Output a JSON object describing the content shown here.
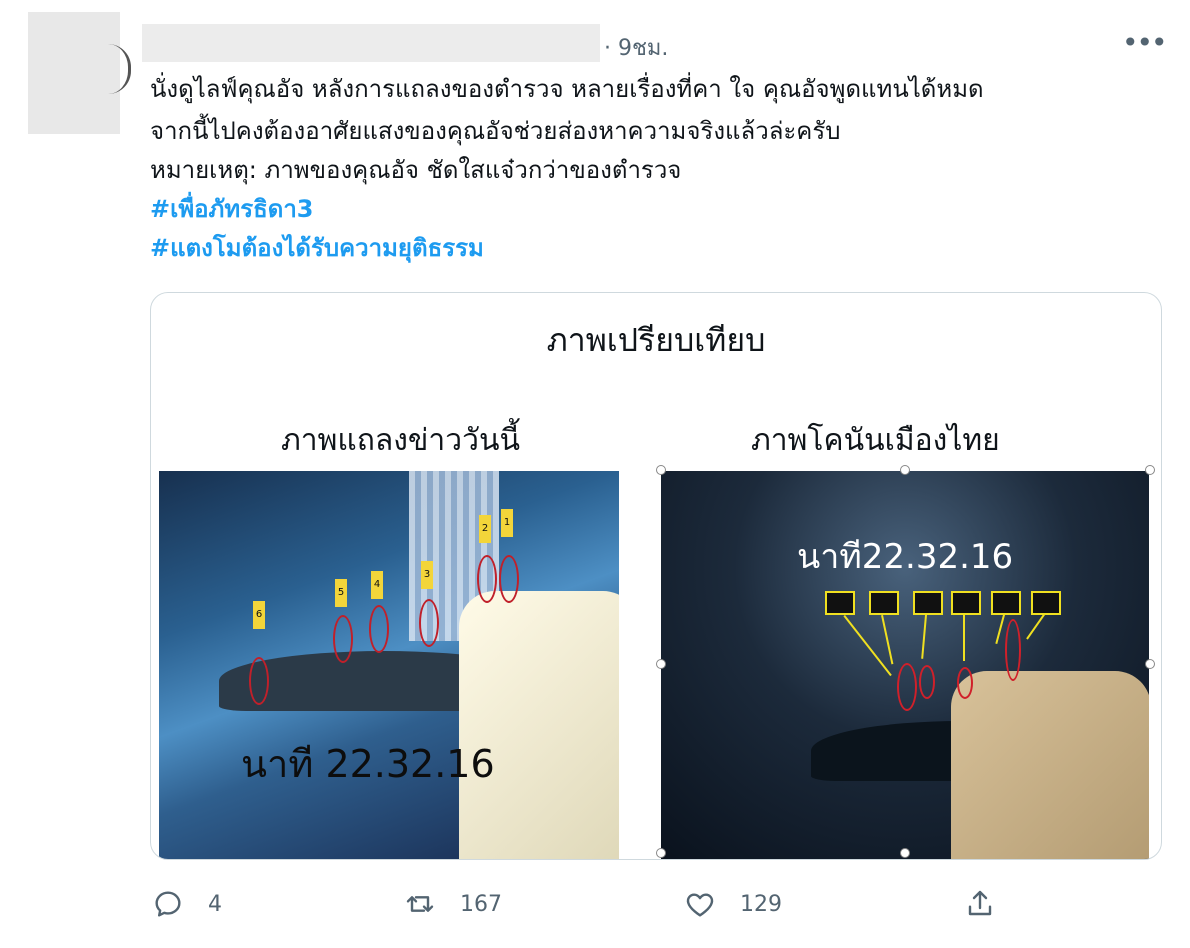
{
  "tweet": {
    "timestamp": "· 9ชม.",
    "more_label": "•••",
    "lines": [
      "นั่งดูไลฟ์คุณอัจ หลังการแถลงของตำรวจ หลายเรื่องที่คา ใจ คุณอัจพูดแทนได้หมด",
      "จากนี้ไปคงต้องอาศัยแสงของคุณอัจช่วยส่องหาความจริงแล้วล่ะครับ",
      "หมายเหตุ: ภาพของคุณอัจ ชัดใสแจ๋วกว่าของตำรวจ"
    ],
    "hashtags": [
      "#เพื่อภัทรธิดา3",
      "#แตงโมต้องได้รับความยุติธรรม"
    ]
  },
  "media": {
    "title": "ภาพเปรียบเทียบ",
    "left_caption": "ภาพแถลงข่าววันนี้",
    "right_caption": "ภาพโคนันเมืองไทย",
    "left_timestamp": "นาที 22.32.16",
    "right_timestamp": "นาที22.32.16",
    "left_tags": [
      "6",
      "5",
      "4",
      "3",
      "2",
      "1"
    ]
  },
  "actions": {
    "reply_count": "4",
    "retweet_count": "167",
    "like_count": "129"
  },
  "icons": {
    "reply": "reply-icon",
    "retweet": "retweet-icon",
    "like": "heart-icon",
    "share": "share-icon"
  },
  "colors": {
    "hashtag": "#1d9bf0",
    "muted": "#536471"
  }
}
